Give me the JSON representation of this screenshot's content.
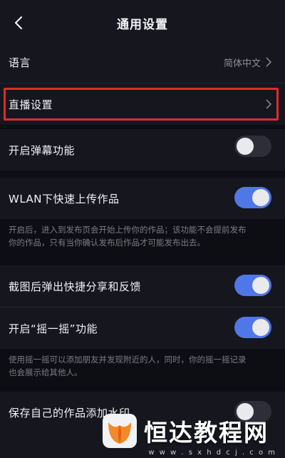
{
  "header": {
    "title": "通用设置",
    "back_icon": "chevron-left-icon"
  },
  "rows": {
    "language": {
      "label": "语言",
      "value": "简体中文"
    },
    "live": {
      "label": "直播设置"
    },
    "danmaku": {
      "label": "开启弹幕功能",
      "enabled": false
    },
    "wlan": {
      "label": "WLAN下快速上传作品",
      "enabled": true
    },
    "screenshot": {
      "label": "截图后弹出快捷分享和反馈",
      "enabled": true
    },
    "shake": {
      "label": "开启“摇一摇”功能",
      "enabled": true
    },
    "watermark_row": {
      "label": "保存自己的作品添加水印",
      "enabled": false
    }
  },
  "descriptions": {
    "wlan_line1": "开启后，进入到发布页会开始上传你的作品；该功能不会提前发布",
    "wlan_line2": "你的作品，只有当你确认发布后作品才可能发布出去。",
    "shake_line1": "使用摇一摇可以添加朋友并发现附近的人，同时，你的摇一摇记录",
    "shake_line2": "也会展示给其他人。"
  },
  "watermark": {
    "brand_text": "恒达教程网",
    "url_text": "w w w . s x h d c j . c o m"
  },
  "colors": {
    "accent": "#4f77e8",
    "highlight": "#e02a2a",
    "background": "#16161f"
  }
}
